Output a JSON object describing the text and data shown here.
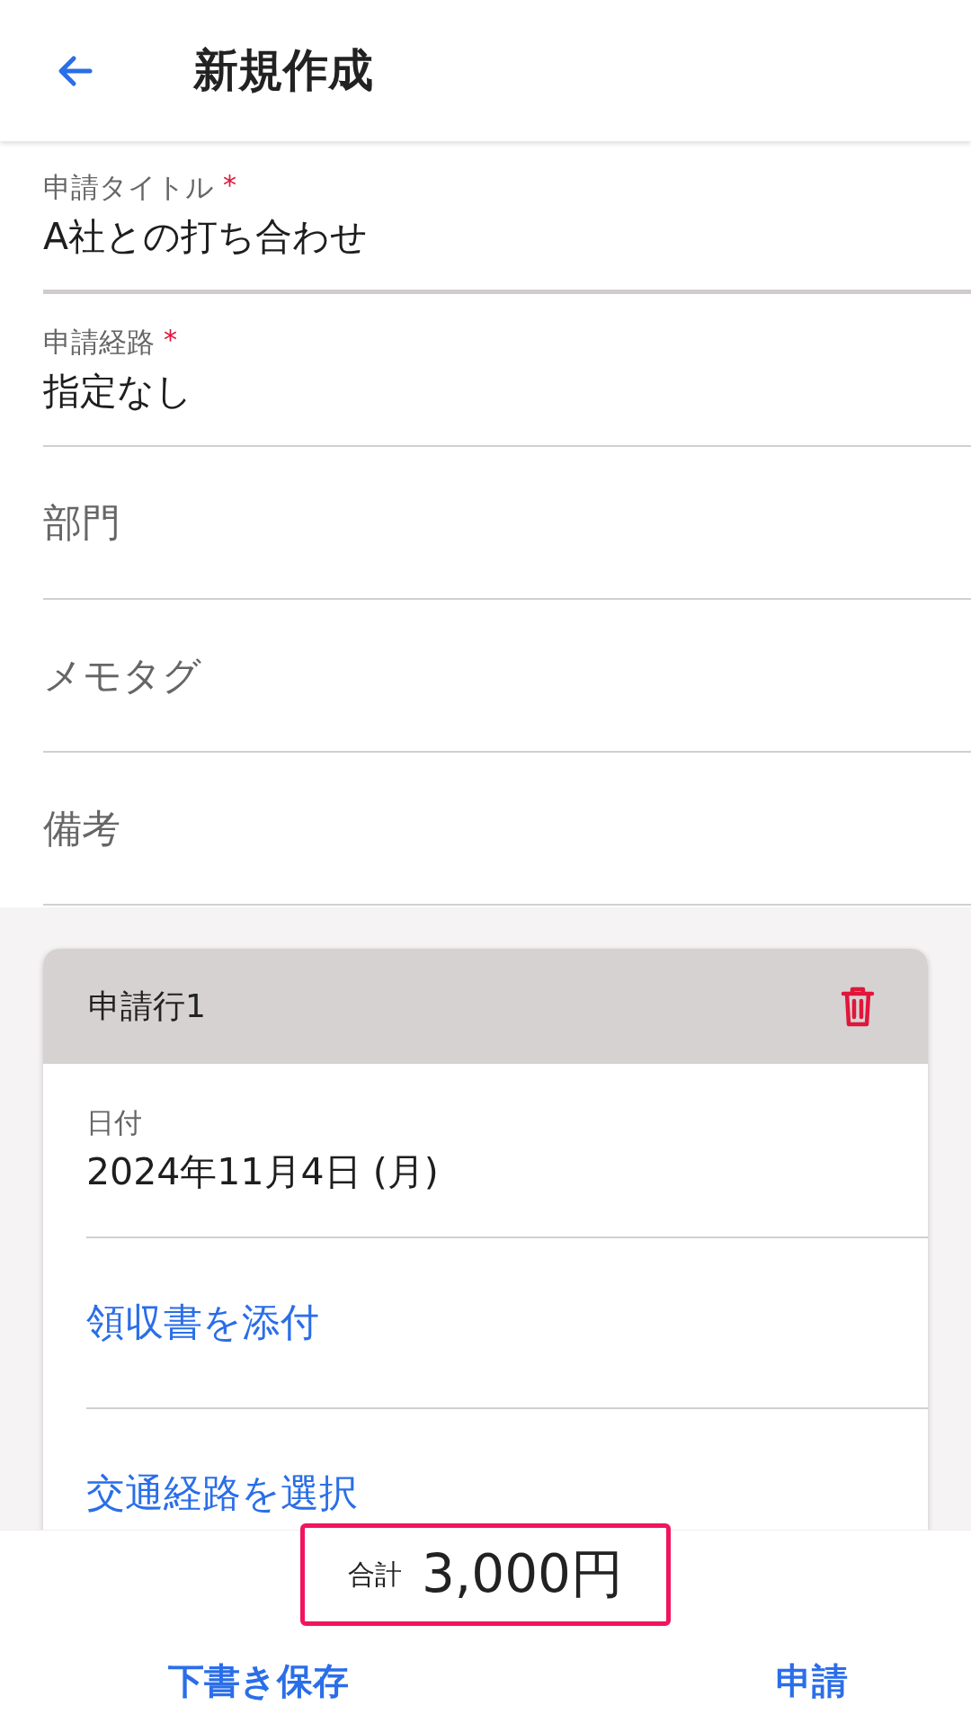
{
  "header": {
    "title": "新規作成"
  },
  "fields": [
    {
      "label": "申請タイトル",
      "required_mark": "*",
      "value": "A社との打ち合わせ",
      "focused": true
    },
    {
      "label": "申請経路",
      "required_mark": "*",
      "value": "指定なし",
      "focused": false
    },
    {
      "placeholder": "部門",
      "focused": false
    },
    {
      "placeholder": "メモタグ",
      "focused": false
    },
    {
      "placeholder": "備考",
      "focused": false
    }
  ],
  "line_card": {
    "title": "申請行1",
    "date": {
      "label": "日付",
      "value": "2024年11月4日 (月)"
    },
    "links": [
      "領収書を添付",
      "交通経路を選択"
    ]
  },
  "total": {
    "label": "合計",
    "amount": "3,000円"
  },
  "actions": [
    {
      "label": "下書き保存"
    },
    {
      "label": "申請"
    }
  ]
}
